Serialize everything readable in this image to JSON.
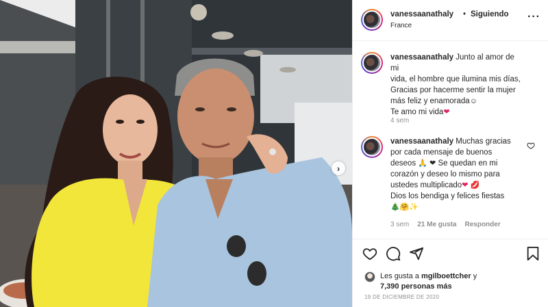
{
  "header": {
    "username": "vanessaanathaly",
    "separator": "•",
    "follow_status": "Siguiendo",
    "location": "France",
    "more_icon": "more-options-icon"
  },
  "comments": [
    {
      "username": "vanessaanathaly",
      "line1": "Junto al amor de mi",
      "line2": "vida, el hombre que ilumina mis días,",
      "line3": "Gracias por hacerme sentir la mujer",
      "line4": "más feliz y enamorada",
      "line4_emoji": "☺",
      "line5": "Te amo mi vida",
      "line5_emoji": "❤",
      "time": "4 sem"
    },
    {
      "username": "vanessaanathaly",
      "line1": "Muchas gracias",
      "line2": "por cada mensaje de buenos",
      "line3": "deseos",
      "line3_emoji": "🙏 ❤",
      "line3b": "Se quedan en mi",
      "line4": "corazón y deseo lo mismo para",
      "line5": "ustedes multiplicado",
      "line5_emoji": "❤ 💋",
      "line6": "Dios los bendiga y felices fiestas",
      "line7_emoji": "🎄🤗✨",
      "time": "3 sem",
      "likes": "21 Me gusta",
      "reply": "Responder"
    }
  ],
  "likes": {
    "prefix": "Les gusta a",
    "user": "mgilboettcher",
    "conj": "y",
    "others": "7,390 personas más"
  },
  "date": "19 DE DICIEMBRE DE 2020",
  "colors": {
    "accent_heart": "#e0245e",
    "muted": "#8e8e8e",
    "border": "#efefef"
  }
}
